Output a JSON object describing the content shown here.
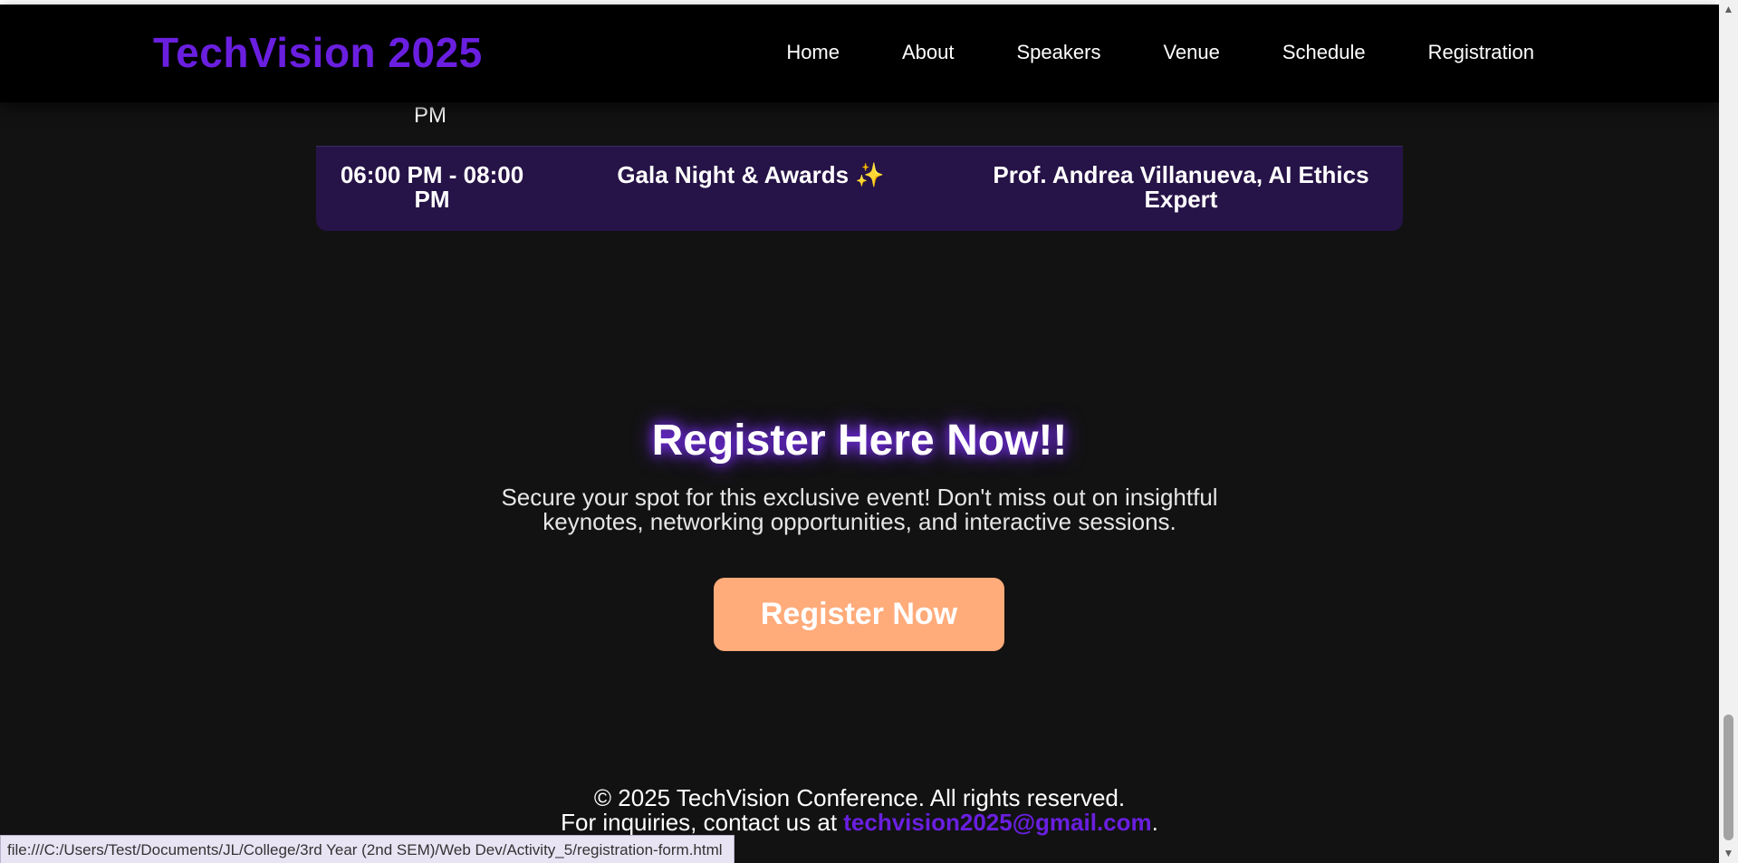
{
  "header": {
    "brand": "TechVision 2025",
    "nav": [
      "Home",
      "About",
      "Speakers",
      "Venue",
      "Schedule",
      "Registration"
    ]
  },
  "schedule": {
    "partial_row": {
      "time_tail": "PM"
    },
    "last_row": {
      "time": "06:00 PM - 08:00 PM",
      "event": "Gala Night & Awards ✨",
      "speaker": "Prof. Andrea Villanueva, AI Ethics Expert"
    }
  },
  "cta": {
    "title": "Register Here Now!!",
    "subtitle": "Secure your spot for this exclusive event! Don't miss out on insightful keynotes, networking opportunities, and interactive sessions.",
    "button_label": "Register Now"
  },
  "footer": {
    "copyright": "© 2025 TechVision Conference. All rights reserved.",
    "contact_prefix": "For inquiries, contact us at ",
    "contact_email": "techvision2025@gmail.com",
    "contact_suffix": "."
  },
  "status_bar": {
    "url": "file:///C:/Users/Test/Documents/JL/College/3rd Year (2nd SEM)/Web Dev/Activity_5/registration-form.html"
  },
  "colors": {
    "brand": "#6a1fe0",
    "background": "#121212",
    "schedule_row": "#261347",
    "button": "#ffab7a",
    "glow": "#7b2ff7"
  },
  "icons": {
    "scroll_up": "triangle-up-icon",
    "scroll_down": "triangle-down-icon"
  }
}
